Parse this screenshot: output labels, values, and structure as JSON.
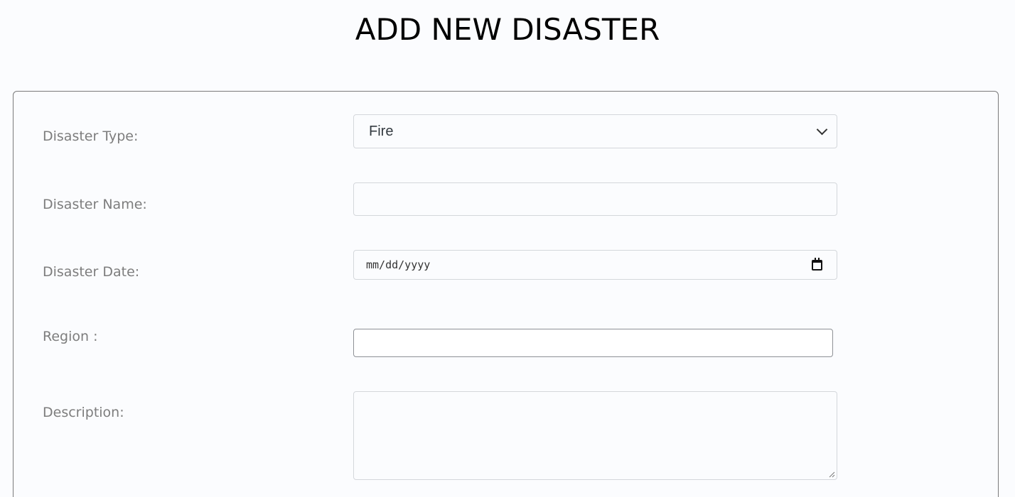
{
  "page": {
    "title": "ADD NEW DISASTER"
  },
  "form": {
    "disaster_type": {
      "label": "Disaster Type:",
      "selected": "Fire"
    },
    "disaster_name": {
      "label": "Disaster Name:",
      "value": ""
    },
    "disaster_date": {
      "label": "Disaster Date:",
      "placeholder": "mm/dd/yyyy"
    },
    "region": {
      "label": "Region :",
      "value": ""
    },
    "description": {
      "label": "Description:",
      "value": ""
    }
  },
  "icons": {
    "select_arrow": "chevron-down-icon",
    "date_picker": "calendar-icon"
  },
  "colors": {
    "background": "#fbfcfe",
    "label": "#7d7d7d",
    "title": "#000000",
    "field_border": "#d4d7db",
    "card_border": "#7a7a7a"
  }
}
